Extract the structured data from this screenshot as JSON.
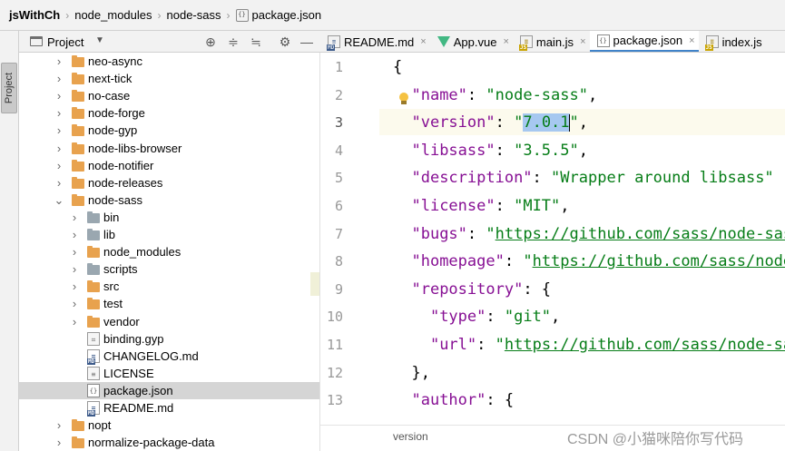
{
  "breadcrumb": {
    "items": [
      "jsWithCh",
      "node_modules",
      "node-sass",
      "package.json"
    ]
  },
  "toolwindow": {
    "side_tab_label": "Project"
  },
  "project_panel": {
    "title": "Project",
    "tree": [
      {
        "label": "neo-async",
        "type": "folder",
        "expanded": false,
        "depth": 1
      },
      {
        "label": "next-tick",
        "type": "folder",
        "expanded": false,
        "depth": 1
      },
      {
        "label": "no-case",
        "type": "folder",
        "expanded": false,
        "depth": 1
      },
      {
        "label": "node-forge",
        "type": "folder",
        "expanded": false,
        "depth": 1
      },
      {
        "label": "node-gyp",
        "type": "folder",
        "expanded": false,
        "depth": 1
      },
      {
        "label": "node-libs-browser",
        "type": "folder",
        "expanded": false,
        "depth": 1
      },
      {
        "label": "node-notifier",
        "type": "folder",
        "expanded": false,
        "depth": 1
      },
      {
        "label": "node-releases",
        "type": "folder",
        "expanded": false,
        "depth": 1
      },
      {
        "label": "node-sass",
        "type": "folder",
        "expanded": true,
        "depth": 1
      },
      {
        "label": "bin",
        "type": "folder-grey",
        "expanded": false,
        "depth": 2
      },
      {
        "label": "lib",
        "type": "folder-grey",
        "expanded": false,
        "depth": 2
      },
      {
        "label": "node_modules",
        "type": "folder",
        "expanded": false,
        "depth": 2
      },
      {
        "label": "scripts",
        "type": "folder-grey",
        "expanded": false,
        "depth": 2
      },
      {
        "label": "src",
        "type": "folder",
        "expanded": false,
        "depth": 2
      },
      {
        "label": "test",
        "type": "folder",
        "expanded": false,
        "depth": 2
      },
      {
        "label": "vendor",
        "type": "folder",
        "expanded": false,
        "depth": 2
      },
      {
        "label": "binding.gyp",
        "type": "file-gyp",
        "depth": 3
      },
      {
        "label": "CHANGELOG.md",
        "type": "file-md",
        "depth": 3
      },
      {
        "label": "LICENSE",
        "type": "file-lic",
        "depth": 3
      },
      {
        "label": "package.json",
        "type": "file-json",
        "depth": 3,
        "selected": true
      },
      {
        "label": "README.md",
        "type": "file-md",
        "depth": 3
      },
      {
        "label": "nopt",
        "type": "folder",
        "expanded": false,
        "depth": 1
      },
      {
        "label": "normalize-package-data",
        "type": "folder",
        "expanded": false,
        "depth": 1
      }
    ]
  },
  "tabs": [
    {
      "label": "README.md",
      "icon": "markdown-icon",
      "active": false
    },
    {
      "label": "App.vue",
      "icon": "vue-icon",
      "active": false
    },
    {
      "label": "main.js",
      "icon": "javascript-icon",
      "active": false
    },
    {
      "label": "package.json",
      "icon": "json-icon",
      "active": true
    },
    {
      "label": "index.js",
      "icon": "javascript-icon",
      "active": false
    }
  ],
  "editor": {
    "current_line": 3,
    "lines": [
      {
        "n": "1",
        "parts": [
          {
            "t": "{",
            "c": ""
          }
        ]
      },
      {
        "n": "2",
        "parts": [
          {
            "t": "  ",
            "c": ""
          },
          {
            "t": "\"name\"",
            "c": "k"
          },
          {
            "t": ": ",
            "c": ""
          },
          {
            "t": "\"node-sass\"",
            "c": "s"
          },
          {
            "t": ",",
            "c": ""
          }
        ]
      },
      {
        "n": "3",
        "parts": [
          {
            "t": "  ",
            "c": ""
          },
          {
            "t": "\"version\"",
            "c": "k"
          },
          {
            "t": ": ",
            "c": ""
          },
          {
            "t": "\"",
            "c": "s"
          },
          {
            "t": "7.0.1",
            "c": "s sel"
          },
          {
            "t": "\"",
            "c": "s"
          },
          {
            "t": ",",
            "c": ""
          }
        ]
      },
      {
        "n": "4",
        "parts": [
          {
            "t": "  ",
            "c": ""
          },
          {
            "t": "\"libsass\"",
            "c": "k"
          },
          {
            "t": ": ",
            "c": ""
          },
          {
            "t": "\"3.5.5\"",
            "c": "s"
          },
          {
            "t": ",",
            "c": ""
          }
        ]
      },
      {
        "n": "5",
        "parts": [
          {
            "t": "  ",
            "c": ""
          },
          {
            "t": "\"description\"",
            "c": "k"
          },
          {
            "t": ": ",
            "c": ""
          },
          {
            "t": "\"Wrapper around libsass\"",
            "c": "s"
          }
        ]
      },
      {
        "n": "6",
        "parts": [
          {
            "t": "  ",
            "c": ""
          },
          {
            "t": "\"license\"",
            "c": "k"
          },
          {
            "t": ": ",
            "c": ""
          },
          {
            "t": "\"MIT\"",
            "c": "s"
          },
          {
            "t": ",",
            "c": ""
          }
        ]
      },
      {
        "n": "7",
        "parts": [
          {
            "t": "  ",
            "c": ""
          },
          {
            "t": "\"bugs\"",
            "c": "k"
          },
          {
            "t": ": ",
            "c": ""
          },
          {
            "t": "\"",
            "c": "s"
          },
          {
            "t": "https://github.com/sass/node-sass/issues",
            "c": "u"
          }
        ]
      },
      {
        "n": "8",
        "parts": [
          {
            "t": "  ",
            "c": ""
          },
          {
            "t": "\"homepage\"",
            "c": "k"
          },
          {
            "t": ": ",
            "c": ""
          },
          {
            "t": "\"",
            "c": "s"
          },
          {
            "t": "https://github.com/sass/node-sass",
            "c": "u"
          }
        ]
      },
      {
        "n": "9",
        "parts": [
          {
            "t": "  ",
            "c": ""
          },
          {
            "t": "\"repository\"",
            "c": "k"
          },
          {
            "t": ": {",
            "c": ""
          }
        ]
      },
      {
        "n": "10",
        "parts": [
          {
            "t": "    ",
            "c": ""
          },
          {
            "t": "\"type\"",
            "c": "k"
          },
          {
            "t": ": ",
            "c": ""
          },
          {
            "t": "\"git\"",
            "c": "s"
          },
          {
            "t": ",",
            "c": ""
          }
        ]
      },
      {
        "n": "11",
        "parts": [
          {
            "t": "    ",
            "c": ""
          },
          {
            "t": "\"url\"",
            "c": "k"
          },
          {
            "t": ": ",
            "c": ""
          },
          {
            "t": "\"",
            "c": "s"
          },
          {
            "t": "https://github.com/sass/node-sass",
            "c": "u"
          }
        ]
      },
      {
        "n": "12",
        "parts": [
          {
            "t": "  },",
            "c": ""
          }
        ]
      },
      {
        "n": "13",
        "parts": [
          {
            "t": "  ",
            "c": ""
          },
          {
            "t": "\"author\"",
            "c": "k"
          },
          {
            "t": ": {",
            "c": ""
          }
        ]
      }
    ]
  },
  "statusbar": {
    "path_text": "version"
  },
  "watermark": "CSDN @小猫咪陪你写代码",
  "colors": {
    "key": "#871094",
    "string": "#067d17",
    "selection": "#a6c8f0",
    "current_line": "#fcfaed",
    "active_tab_underline": "#4083c9",
    "folder": "#e8a24e"
  }
}
